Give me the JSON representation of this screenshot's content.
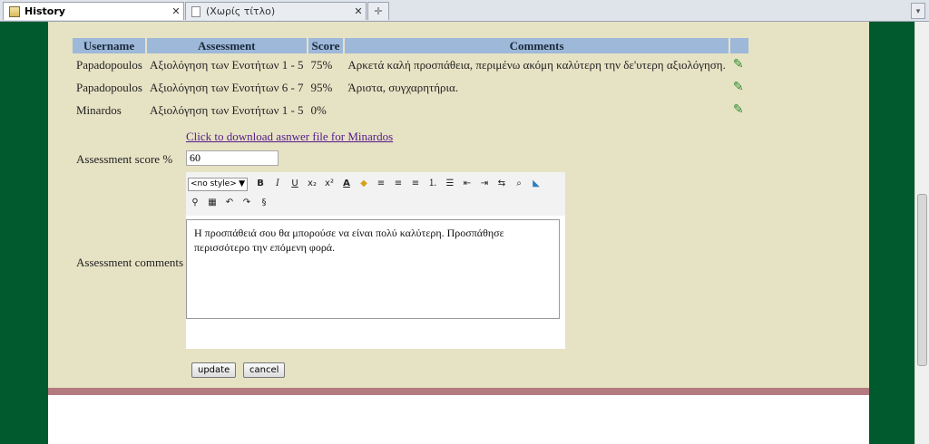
{
  "tabs": [
    {
      "label": "History"
    },
    {
      "label": "(Χωρίς τίτλο)"
    }
  ],
  "table": {
    "headers": [
      "Username",
      "Assessment",
      "Score",
      "Comments"
    ],
    "rows": [
      {
        "username": "Papadopoulos",
        "assessment": "Αξιολόγηση των Ενοτήτων 1 - 5",
        "score": "75%",
        "comments": "Αρκετά καλή προσπάθεια, περιμένω ακόμη καλύτερη την δε'υτερη αξιολόγηση."
      },
      {
        "username": "Papadopoulos",
        "assessment": "Αξιολόγηση των Ενοτήτων 6 - 7",
        "score": "95%",
        "comments": "Άριστα, συγχαρητήρια."
      },
      {
        "username": "Minardos",
        "assessment": "Αξιολόγηση των Ενοτήτων 1 - 5",
        "score": "0%",
        "comments": ""
      }
    ]
  },
  "download_link": "Click to download asnwer file for Minardos",
  "form": {
    "score_label": "Assessment score %",
    "score_value": "60",
    "comments_label": "Assessment comments",
    "style_select": "<no style>",
    "comment_text": "Η προσπάθειά σου θα μπορούσε να είναι πολύ καλύτερη. Προσπάθησε περισσότερο την επόμενη φορά.",
    "update_label": "update",
    "cancel_label": "cancel"
  },
  "colors": {
    "page_bg": "#005a2e",
    "content_bg": "#e6e2c4",
    "header_bg": "#9db8d9",
    "divider": "#b47a80"
  }
}
